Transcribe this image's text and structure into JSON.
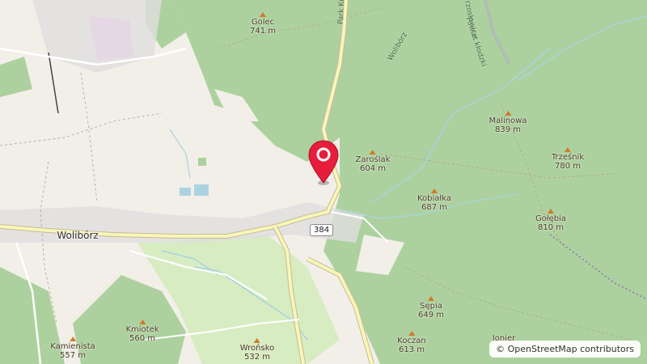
{
  "map": {
    "colors": {
      "land": "#f2efe9",
      "forest": "#add19e",
      "road_yellow": "#f6f7b6",
      "water": "#aad3df",
      "pin": "#e61e3c"
    },
    "town": {
      "name": "Wolibórz"
    },
    "road_shield": {
      "number": "384"
    },
    "park_label": "Park Kr…",
    "road_label_1": "Wolibórz",
    "district_label": "Powiat kłodzki",
    "district_label_2": "rzosłowice",
    "peaks": [
      {
        "name": "Golec",
        "elev": "741 m"
      },
      {
        "name": "Zarośl­ak",
        "elev": "604 m"
      },
      {
        "name": "Malinowa",
        "elev": "839 m"
      },
      {
        "name": "Trześnik",
        "elev": "780 m"
      },
      {
        "name": "Kobiałka",
        "elev": "687 m"
      },
      {
        "name": "Gołębia",
        "elev": "810 m"
      },
      {
        "name": "Sępia",
        "elev": "649 m"
      },
      {
        "name": "Kmiotek",
        "elev": "560 m"
      },
      {
        "name": "Kamienista",
        "elev": "557 m"
      },
      {
        "name": "Wrońsko",
        "elev": "532 m"
      },
      {
        "name": "Koczan",
        "elev": "613 m"
      },
      {
        "name": "Jonier",
        "elev": ""
      }
    ],
    "marker": {
      "icon": "location-pin-icon"
    },
    "attribution": {
      "symbol": "©",
      "text": "OpenStreetMap contributors"
    }
  }
}
